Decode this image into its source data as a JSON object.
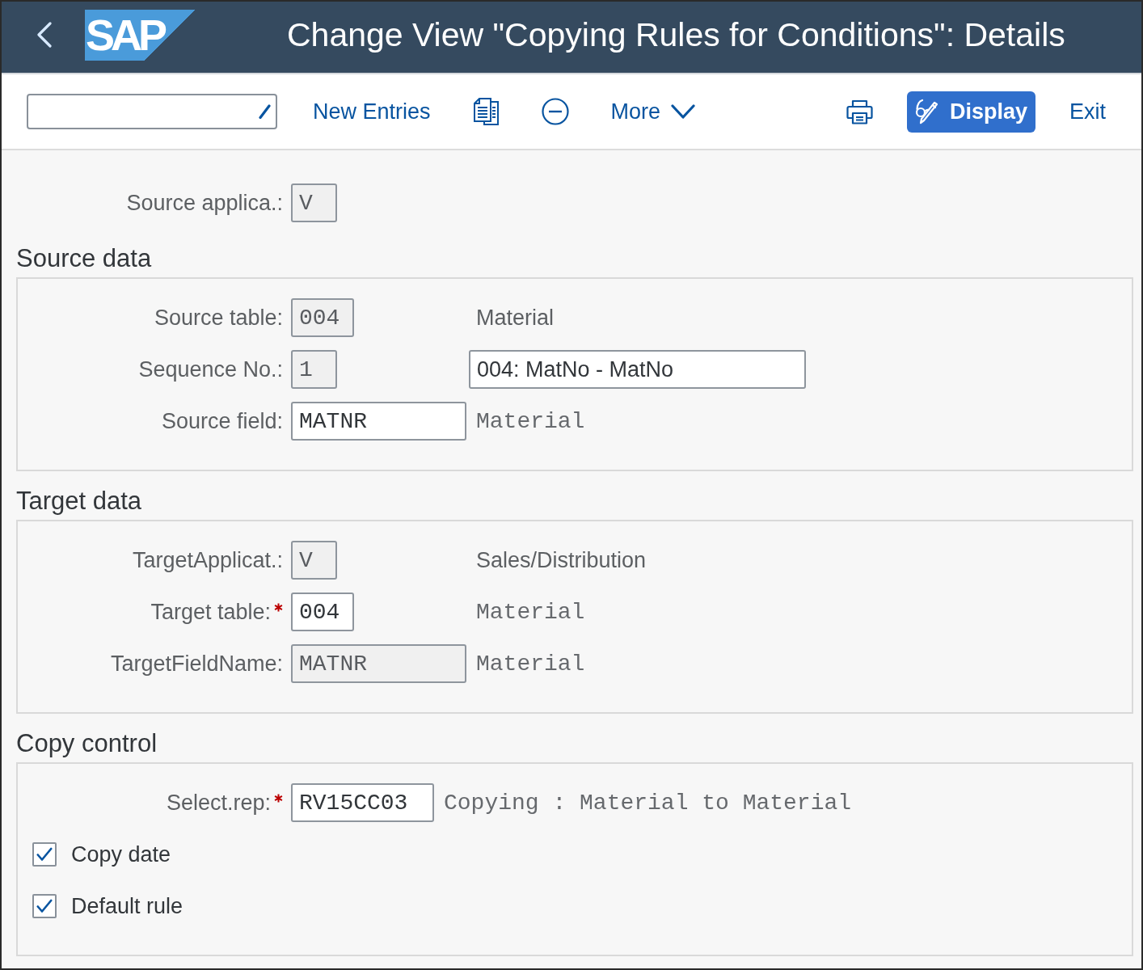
{
  "header": {
    "logo": "SAP",
    "title": "Change View \"Copying Rules for Conditions\": Details"
  },
  "toolbar": {
    "actions": [
      {
        "kind": "link",
        "label": "New Entries"
      },
      {
        "kind": "copy"
      },
      {
        "kind": "delete"
      },
      {
        "kind": "menu",
        "label": "More"
      }
    ],
    "end_actions": [
      {
        "kind": "print"
      },
      {
        "kind": "emphasized",
        "label": "Display"
      },
      {
        "kind": "link",
        "label": "Exit"
      }
    ]
  },
  "header_fields": [
    {
      "label": "Source applica.:",
      "required": false,
      "value": "V",
      "disabled": true
    }
  ],
  "sections": [
    {
      "title": "Source data",
      "rows": [
        {
          "label": "Source table:",
          "required": false,
          "value": "004",
          "disabled": true,
          "description": {
            "kind": "text",
            "text": "Material"
          }
        },
        {
          "label": "Sequence No.:",
          "required": false,
          "value": "1",
          "disabled": true,
          "description": {
            "kind": "field",
            "text": "004: MatNo - MatNo"
          }
        },
        {
          "label": "Source field:",
          "required": false,
          "value": "MATNR",
          "disabled": false,
          "description": {
            "kind": "code",
            "text": "Material"
          }
        }
      ]
    },
    {
      "title": "Target data",
      "rows": [
        {
          "label": "TargetApplicat.:",
          "required": false,
          "value": "V",
          "disabled": true,
          "description": {
            "kind": "text",
            "text": "Sales/Distribution"
          }
        },
        {
          "label": "Target table:",
          "required": true,
          "value": "004",
          "disabled": false,
          "description": {
            "kind": "code",
            "text": "Material"
          }
        },
        {
          "label": "TargetFieldName:",
          "required": false,
          "value": "MATNR",
          "disabled": true,
          "description": {
            "kind": "code",
            "text": "Material"
          }
        }
      ]
    },
    {
      "title": "Copy control",
      "rows": [
        {
          "label": "Select.rep:",
          "required": true,
          "value": "RV15CC03",
          "disabled": false,
          "description": {
            "kind": "code",
            "text": "Copying : Material to Material"
          }
        }
      ],
      "checkboxes": [
        {
          "label": "Copy date",
          "checked": true
        },
        {
          "label": "Default rule",
          "checked": true
        }
      ]
    }
  ]
}
